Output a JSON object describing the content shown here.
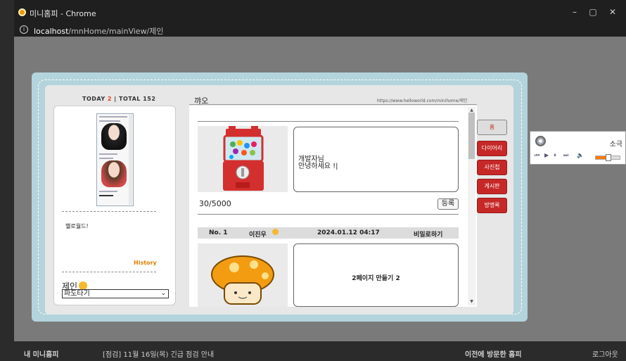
{
  "window": {
    "title": "미니홈피 - Chrome",
    "controls": {
      "minimize": "–",
      "maximize": "▢",
      "close": "✕"
    }
  },
  "address_bar": {
    "host": "localhost",
    "path": "/mnHome/mainView/제인"
  },
  "visitor_counter": {
    "today_label": "TODAY",
    "today_count": "2",
    "separator": "|",
    "total_label": "TOTAL",
    "total_count": "152"
  },
  "profile": {
    "greeting": "헬로월드!",
    "history_link": "History",
    "owner_name": "제인",
    "friends_select": {
      "selected": "파도타기",
      "caret": "⌄"
    }
  },
  "main": {
    "heading": "꺄오",
    "home_url": "https://www.helloworld.com/minihome/제인",
    "compose": {
      "text_line1": "개발자님",
      "text_line2": "안녕하세요 !|",
      "char_count": "30/5000",
      "submit_label": "등록"
    },
    "entries": [
      {
        "number": "No. 1",
        "author": "이진우",
        "date": "2024.01.12 04:17",
        "action": "비밀로하기",
        "content": "2페이지 만들기 2"
      }
    ]
  },
  "tabs": [
    {
      "label": "홈",
      "active": true
    },
    {
      "label": "다이어리",
      "active": false
    },
    {
      "label": "사진첩",
      "active": false
    },
    {
      "label": "게시판",
      "active": false
    },
    {
      "label": "방명록",
      "active": false
    }
  ],
  "music_player": {
    "title": "소극",
    "controls": {
      "prev": "⏮",
      "play": "▶",
      "pause": "⏸",
      "next": "⏭",
      "volume": "🔈"
    },
    "volume_level": 0.5
  },
  "footer": {
    "my_minihome": "내 미니홈피",
    "notice": "[점검] 11월 16일(목) 긴급 점검 안내",
    "previous_visit": "이전에 방문한 홈피",
    "logout": "로그아웃"
  },
  "colors": {
    "accent_red": "#c62828",
    "book_blue": "#b3d4dc",
    "history_orange": "#e08000"
  }
}
